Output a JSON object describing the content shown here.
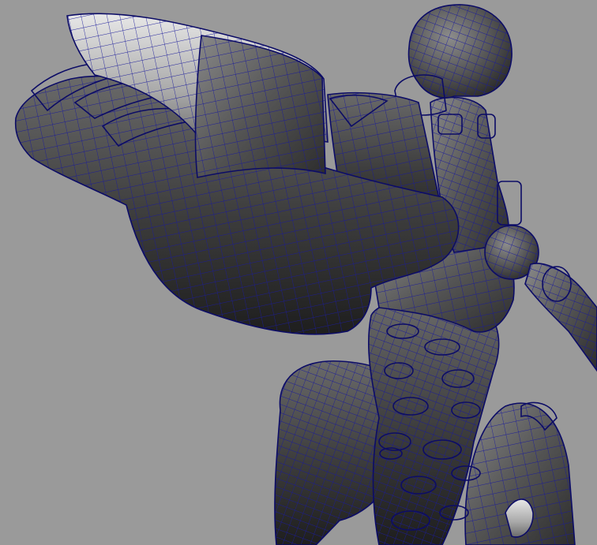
{
  "viewport": {
    "background_color": "#9a9a9a",
    "display_mode": "wireframe-on-shaded",
    "wire_color": "#1a1a9a",
    "shade_color": "#4a4a4a",
    "highlight_color": "#d6d6d6"
  },
  "model": {
    "parts": [
      "skull-mesh",
      "upper-arm-mesh",
      "forearm-mesh",
      "shoulder-pad-mesh",
      "shoulder-strap-mesh",
      "torso-plate-mesh",
      "spine-mesh",
      "rib-cage-mesh",
      "pelvis-left-mesh",
      "pelvis-right-mesh"
    ]
  }
}
